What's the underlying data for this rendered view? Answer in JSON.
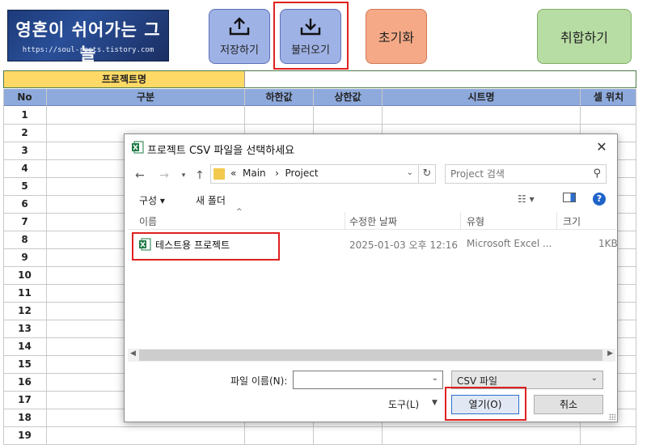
{
  "sheet": {
    "logo": {
      "title": "영혼이 쉬어가는 그늘",
      "url": "https://soul-rests.tistory.com"
    },
    "buttons": {
      "save": "저장하기",
      "load": "불러오기",
      "reset": "초기화",
      "weakness": "취합하기"
    },
    "project_label": "프로젝트명",
    "project_value": "",
    "headers": {
      "no": "No",
      "category": "구분",
      "lower": "하한값",
      "upper": "상한값",
      "sheet_name": "시트명",
      "cell_pos": "셀 위치"
    },
    "row_numbers": [
      "1",
      "2",
      "3",
      "4",
      "5",
      "6",
      "7",
      "8",
      "9",
      "10",
      "11",
      "12",
      "13",
      "14",
      "15",
      "16",
      "17",
      "18",
      "19"
    ]
  },
  "dialog": {
    "title": "프로젝트 CSV 파일을 선택하세요",
    "address": {
      "prefix": "«",
      "crumbs": [
        "Main",
        "Project"
      ]
    },
    "search_placeholder": "Project 검색",
    "toolbar": {
      "organize": "구성 ▾",
      "new_folder": "새 폴더",
      "help": "?"
    },
    "columns": {
      "name": "이름",
      "modified": "수정한 날짜",
      "type": "유형",
      "size": "크기"
    },
    "files": [
      {
        "name": "테스트용 프로젝트",
        "modified": "2025-01-03 오후 12:16",
        "type": "Microsoft Excel ...",
        "size": "1KB"
      }
    ],
    "filename_label": "파일 이름(N):",
    "filename_value": "",
    "filetype_value": "CSV 파일",
    "tools_label": "도구(L)",
    "open_label": "열기(O)",
    "cancel_label": "취소"
  },
  "colors": {
    "header_blue": "#8ea9db",
    "project_yellow": "#ffd966",
    "save_btn": "#9fb2e6",
    "reset_btn": "#f5a987",
    "weak_btn": "#b8dda4",
    "highlight_red": "#e02020"
  }
}
